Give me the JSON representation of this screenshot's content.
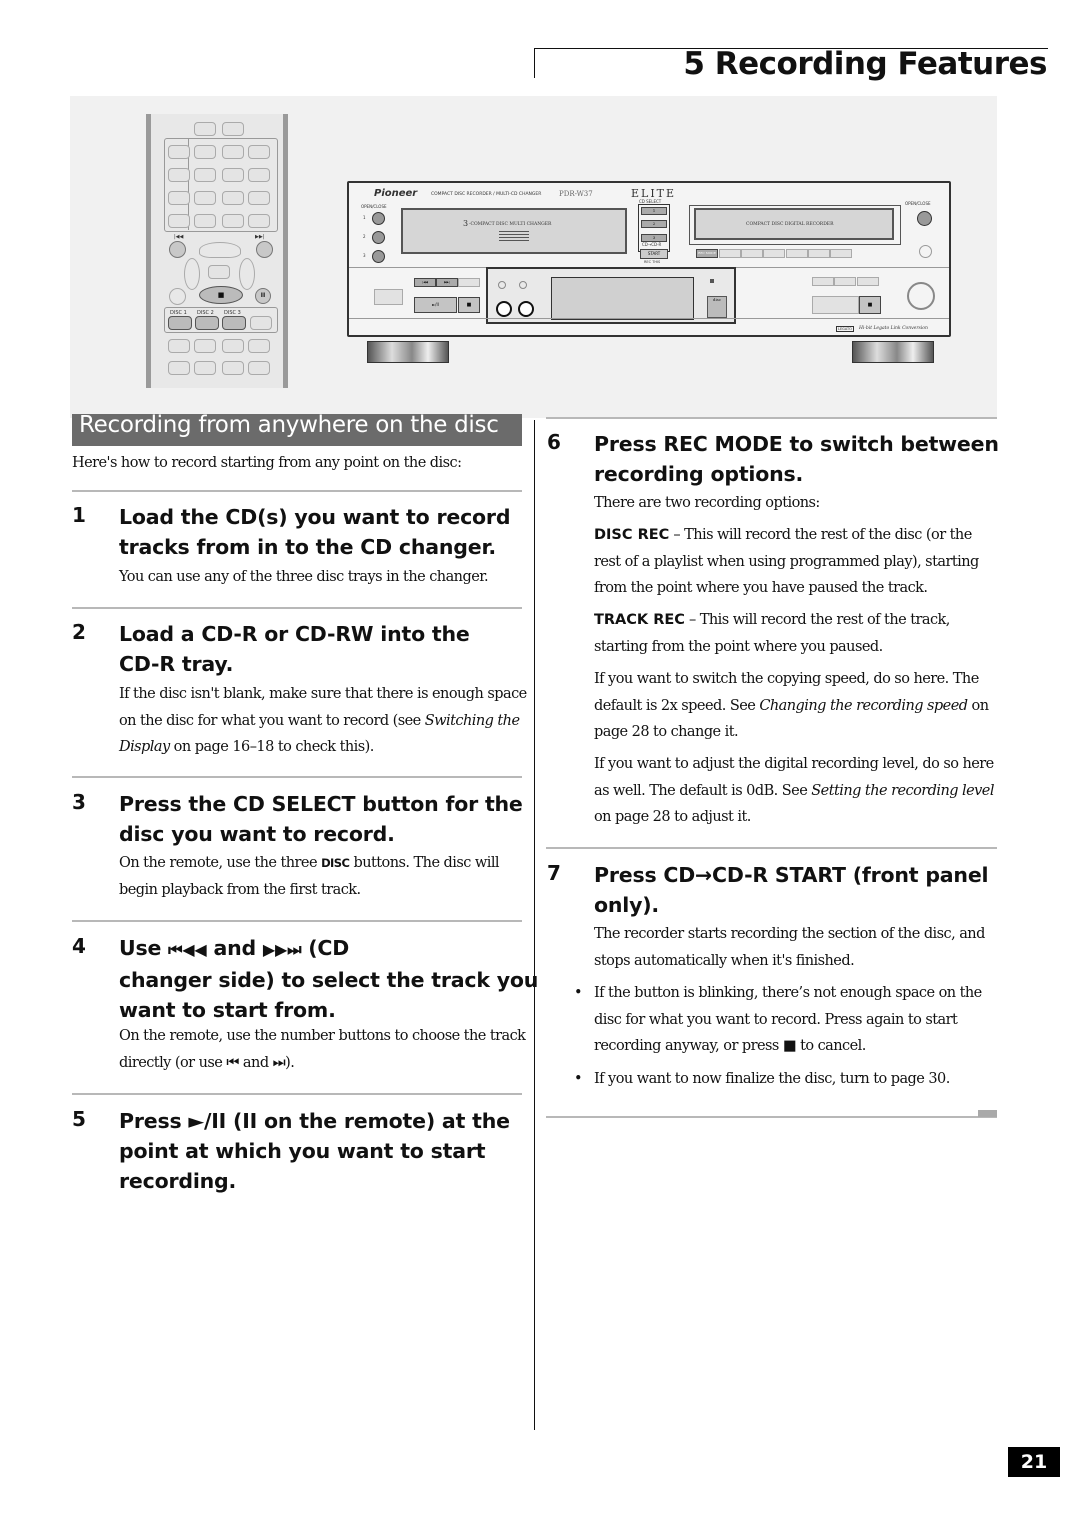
{
  "header": {
    "chapter_title": "5 Recording Features"
  },
  "figure": {
    "remote": {
      "disc_buttons": [
        "DISC 1",
        "DISC 2",
        "DISC 3"
      ],
      "icons": [
        "previous-track-icon",
        "next-track-icon",
        "stop-icon",
        "pause-icon"
      ]
    },
    "deck": {
      "brand": "Pioneer",
      "subtitle": "COMPACT DISC RECORDER / MULTI-CD CHANGER",
      "model": "PDR-W37",
      "series": "ELITE",
      "open_close_left": "OPEN/CLOSE",
      "open_close_right": "OPEN/CLOSE",
      "tray_numbers": [
        "1",
        "2",
        "3"
      ],
      "changer_label_prefix": "3",
      "changer_label": "-COMPACT DISC MULTI CHANGER",
      "recorder_label": "COMPACT DISC DIGITAL RECORDER",
      "cd_select_label": "CD SELECT",
      "cd_select_buttons": [
        "1",
        "2",
        "3"
      ],
      "cd_to_cdr_label": "CD→CD-R",
      "start_label": "START",
      "rec_this_label": "REC THIS",
      "rec_mode_label": "REC MODE",
      "play_pause_label": "►/II",
      "legato_label": "Hi-bit Legato Link Conversion",
      "legato_badge": "LEGATO"
    }
  },
  "section": {
    "title": "Recording from anywhere on the disc",
    "intro": "Here's how to record starting from any point on the disc:"
  },
  "steps": [
    {
      "number": "1",
      "heading_lines": [
        "Load the CD(s) you want to record",
        "tracks from in to the CD changer."
      ],
      "body": "You can use any of the three disc trays in the changer."
    },
    {
      "number": "2",
      "heading_lines": [
        "Load a CD-R or CD-RW into the",
        "CD-R tray."
      ],
      "body_lines": [
        {
          "pre": "If the disc isn't blank, make sure that there is enough space"
        },
        {
          "pre": "on the disc for what you want to record (see ",
          "italic": "Switching the"
        },
        {
          "italic": "Display",
          "post": " on page 16–18 to check this)."
        }
      ]
    },
    {
      "number": "3",
      "heading_lines": [
        "Press the CD SELECT button for the",
        "disc you want to record."
      ],
      "body_pre": "On the remote, use the three ",
      "body_kw": "DISC",
      "body_post": " buttons. The disc will",
      "body_line2": "begin playback from the first track."
    },
    {
      "number": "4",
      "heading_line1_pre": "Use ",
      "heading_line1_sym1": "⏮◀◀",
      "heading_line1_mid": " and ",
      "heading_line1_sym2": "▶▶⏭",
      "heading_line1_post": " (CD",
      "heading_lines_rest": [
        "changer side) to select the track you",
        "want to start from."
      ],
      "body_line1": "On the remote, use the number buttons to choose the track",
      "body_line2_pre": "directly (or use ",
      "body_line2_sym1": "⏮",
      "body_line2_mid": " and ",
      "body_line2_sym2": "⏭",
      "body_line2_post": ")."
    },
    {
      "number": "5",
      "heading_line1_pre": "Press ",
      "heading_line1_sym": "►/II",
      "heading_line1_mid": " (",
      "heading_line1_sym2": "II",
      "heading_line1_post": " on the remote) at the",
      "heading_lines_rest": [
        "point at which you want to start",
        "recording."
      ]
    },
    {
      "number": "6",
      "heading_lines": [
        "Press REC MODE to switch between",
        "recording options."
      ],
      "intro": "There are two recording options:",
      "options": [
        {
          "name": "DISC REC",
          "lines": [
            " – This will record the rest of the disc (or the",
            "rest of a playlist when using programmed play), starting",
            "from the point where you have paused the track."
          ]
        },
        {
          "name": "TRACK REC",
          "lines": [
            " – This will record the rest of the track,",
            "starting from the point where you paused."
          ]
        }
      ],
      "speed_lines": [
        {
          "pre": "If you want to switch the copying speed, do so here. The"
        },
        {
          "pre": "default is 2x speed. See ",
          "italic": "Changing the recording speed",
          "post": " on"
        },
        {
          "pre": "page 28 to change it."
        }
      ],
      "level_lines": [
        {
          "pre": "If you want to adjust the digital recording level, do so here"
        },
        {
          "pre": "as well. The default is 0dB. See ",
          "italic": "Setting the recording level"
        },
        {
          "pre": "on page 28 to adjust it."
        }
      ]
    },
    {
      "number": "7",
      "heading_line1_pre": "Press CD",
      "heading_line1_arrow": "→",
      "heading_line1_post": "CD-R START (front panel",
      "heading_lines_rest": [
        "only)."
      ],
      "body_lines": [
        "The recorder starts recording the section of the disc, and",
        "stops automatically when it's finished."
      ],
      "bullets": [
        {
          "lines": [
            "If the button is blinking, there’s not enough space on the",
            "disc for what you want to record. Press again to start"
          ],
          "last_pre": "recording anyway, or press ",
          "last_sym": "■",
          "last_post": " to cancel."
        },
        {
          "lines": [
            "If you want to now finalize the disc, turn to page 30."
          ]
        }
      ]
    }
  ],
  "footer": {
    "page_number": "21"
  }
}
